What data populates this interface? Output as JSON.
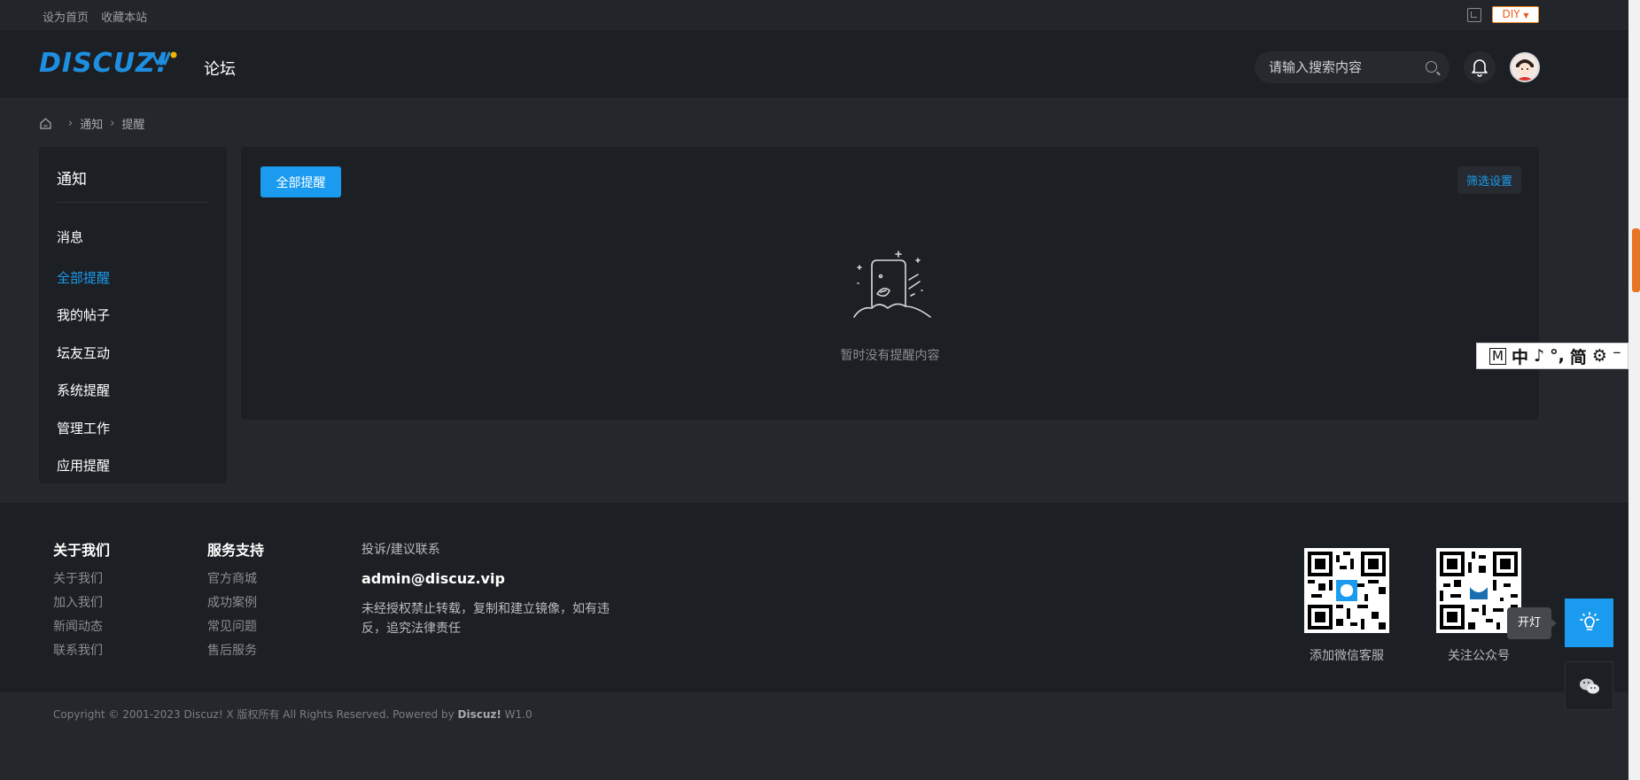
{
  "topbar": {
    "set_home": "设为首页",
    "bookmark": "收藏本站",
    "diy_label": "DIY"
  },
  "header": {
    "logo_text": "DISCUZ!",
    "nav_forum": "论坛",
    "search_placeholder": "请输入搜索内容"
  },
  "breadcrumb": {
    "separator": "›",
    "items": [
      "通知",
      "提醒"
    ]
  },
  "sidebar": {
    "title": "通知",
    "items": [
      {
        "label": "消息"
      },
      {
        "label": "全部提醒"
      },
      {
        "label": "我的帖子"
      },
      {
        "label": "坛友互动"
      },
      {
        "label": "系统提醒"
      },
      {
        "label": "管理工作"
      },
      {
        "label": "应用提醒"
      }
    ]
  },
  "main": {
    "tab_label": "全部提醒",
    "filter_label": "筛选设置",
    "empty_text": "暂时没有提醒内容"
  },
  "ime": {
    "m": "M",
    "zh": "中",
    "moon": "♪",
    "punct": "°,",
    "simp": "简",
    "gear": "⚙",
    "extra": "⁻"
  },
  "footer": {
    "about": {
      "title": "关于我们",
      "links": [
        "关于我们",
        "加入我们",
        "新闻动态",
        "联系我们"
      ]
    },
    "support": {
      "title": "服务支持",
      "links": [
        "官方商城",
        "成功案例",
        "常见问题",
        "售后服务"
      ]
    },
    "contact": {
      "label": "投诉/建议联系",
      "email": "admin@discuz.vip",
      "note": "未经授权禁止转载，复制和建立镜像，如有违反，追究法律责任"
    },
    "qr_service_label": "添加微信客服",
    "qr_official_label": "关注公众号"
  },
  "copyright": {
    "text": "Copyright © 2001-2023 Discuz! X 版权所有 All Rights Reserved. Powered by ",
    "brand": "Discuz!",
    "version": " W1.0"
  },
  "floating": {
    "tooltip": "开灯"
  },
  "colors": {
    "accent": "#1a9bf0",
    "background": "#24272c",
    "panel": "#1c1f23"
  }
}
